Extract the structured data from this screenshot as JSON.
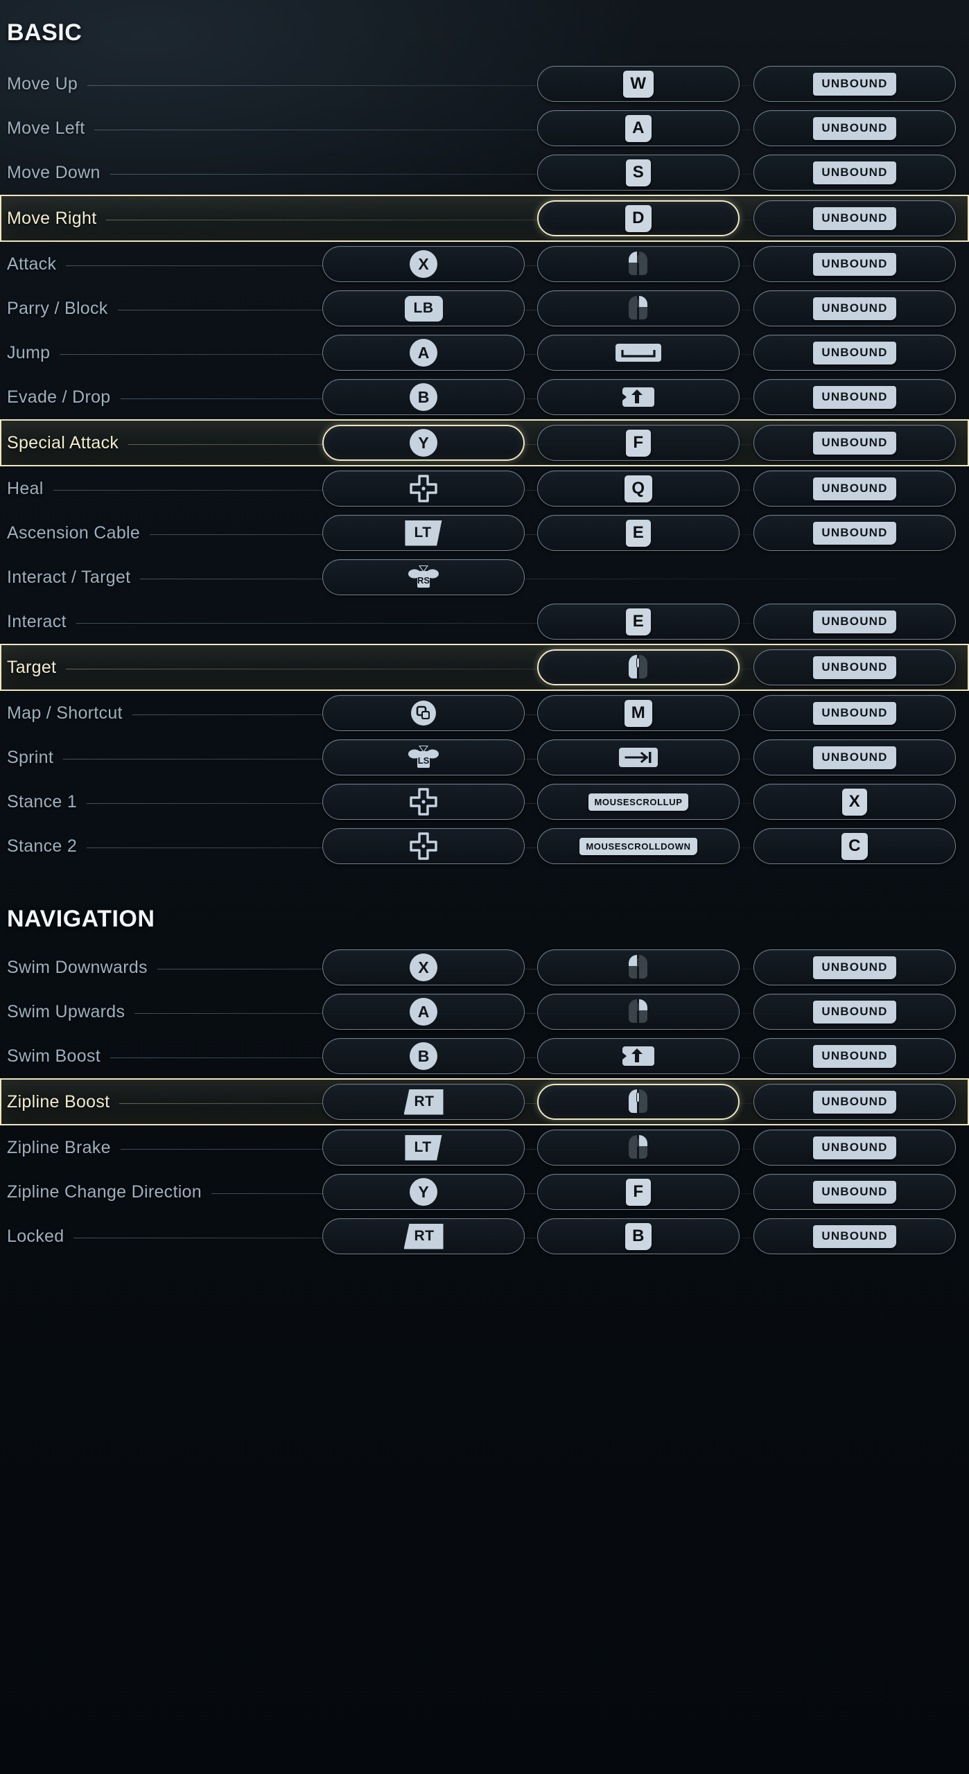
{
  "sections": [
    {
      "title": "BASIC",
      "rows": [
        {
          "label": "Move Up",
          "selected": false,
          "slots": [
            null,
            {
              "type": "keycap",
              "text": "W"
            },
            {
              "type": "unbound",
              "text": "UNBOUND"
            }
          ]
        },
        {
          "label": "Move Left",
          "selected": false,
          "slots": [
            null,
            {
              "type": "keycap",
              "text": "A"
            },
            {
              "type": "unbound",
              "text": "UNBOUND"
            }
          ]
        },
        {
          "label": "Move Down",
          "selected": false,
          "slots": [
            null,
            {
              "type": "keycap",
              "text": "S"
            },
            {
              "type": "unbound",
              "text": "UNBOUND"
            }
          ]
        },
        {
          "label": "Move Right",
          "selected": true,
          "activeSlot": 1,
          "slots": [
            null,
            {
              "type": "keycap",
              "text": "D"
            },
            {
              "type": "unbound",
              "text": "UNBOUND"
            }
          ]
        },
        {
          "label": "Attack",
          "selected": false,
          "slots": [
            {
              "type": "face",
              "text": "X"
            },
            {
              "type": "icon",
              "icon": "mouse-left-icon"
            },
            {
              "type": "unbound",
              "text": "UNBOUND"
            }
          ]
        },
        {
          "label": "Parry / Block",
          "selected": false,
          "slots": [
            {
              "type": "bumper",
              "text": "LB"
            },
            {
              "type": "icon",
              "icon": "mouse-right-icon"
            },
            {
              "type": "unbound",
              "text": "UNBOUND"
            }
          ]
        },
        {
          "label": "Jump",
          "selected": false,
          "slots": [
            {
              "type": "face",
              "text": "A"
            },
            {
              "type": "icon",
              "icon": "spacebar-icon"
            },
            {
              "type": "unbound",
              "text": "UNBOUND"
            }
          ]
        },
        {
          "label": "Evade / Drop",
          "selected": false,
          "slots": [
            {
              "type": "face",
              "text": "B"
            },
            {
              "type": "icon",
              "icon": "shift-key-icon"
            },
            {
              "type": "unbound",
              "text": "UNBOUND"
            }
          ]
        },
        {
          "label": "Special Attack",
          "selected": true,
          "activeSlot": 0,
          "slots": [
            {
              "type": "face",
              "text": "Y"
            },
            {
              "type": "keycap",
              "text": "F"
            },
            {
              "type": "unbound",
              "text": "UNBOUND"
            }
          ]
        },
        {
          "label": "Heal",
          "selected": false,
          "slots": [
            {
              "type": "icon",
              "icon": "dpad-icon"
            },
            {
              "type": "keycap",
              "text": "Q"
            },
            {
              "type": "unbound",
              "text": "UNBOUND"
            }
          ]
        },
        {
          "label": "Ascension Cable",
          "selected": false,
          "slots": [
            {
              "type": "trigger",
              "text": "LT"
            },
            {
              "type": "keycap",
              "text": "E"
            },
            {
              "type": "unbound",
              "text": "UNBOUND"
            }
          ]
        },
        {
          "label": "Interact / Target",
          "selected": false,
          "slots": [
            {
              "type": "icon",
              "icon": "right-stick-icon",
              "text": "RS"
            },
            null,
            null
          ]
        },
        {
          "label": "Interact",
          "selected": false,
          "slots": [
            null,
            {
              "type": "keycap",
              "text": "E"
            },
            {
              "type": "unbound",
              "text": "UNBOUND"
            }
          ]
        },
        {
          "label": "Target",
          "selected": true,
          "activeSlot": 1,
          "slots": [
            null,
            {
              "type": "icon",
              "icon": "mouse-middle-icon"
            },
            {
              "type": "unbound",
              "text": "UNBOUND"
            }
          ]
        },
        {
          "label": "Map / Shortcut",
          "selected": false,
          "slots": [
            {
              "type": "icon",
              "icon": "view-button-icon"
            },
            {
              "type": "keycap",
              "text": "M"
            },
            {
              "type": "unbound",
              "text": "UNBOUND"
            }
          ]
        },
        {
          "label": "Sprint",
          "selected": false,
          "slots": [
            {
              "type": "icon",
              "icon": "left-stick-icon",
              "text": "LS"
            },
            {
              "type": "icon",
              "icon": "tab-key-icon"
            },
            {
              "type": "unbound",
              "text": "UNBOUND"
            }
          ]
        },
        {
          "label": "Stance 1",
          "selected": false,
          "slots": [
            {
              "type": "icon",
              "icon": "dpad-icon"
            },
            {
              "type": "keycap-wide",
              "text": "MOUSESCROLLUP"
            },
            {
              "type": "keycap",
              "text": "X"
            }
          ]
        },
        {
          "label": "Stance 2",
          "selected": false,
          "slots": [
            {
              "type": "icon",
              "icon": "dpad-icon"
            },
            {
              "type": "keycap-wide",
              "text": "MOUSESCROLLDOWN"
            },
            {
              "type": "keycap",
              "text": "C"
            }
          ]
        }
      ]
    },
    {
      "title": "NAVIGATION",
      "rows": [
        {
          "label": "Swim Downwards",
          "selected": false,
          "slots": [
            {
              "type": "face",
              "text": "X"
            },
            {
              "type": "icon",
              "icon": "mouse-left-icon"
            },
            {
              "type": "unbound",
              "text": "UNBOUND"
            }
          ]
        },
        {
          "label": "Swim Upwards",
          "selected": false,
          "slots": [
            {
              "type": "face",
              "text": "A"
            },
            {
              "type": "icon",
              "icon": "mouse-right-icon"
            },
            {
              "type": "unbound",
              "text": "UNBOUND"
            }
          ]
        },
        {
          "label": "Swim Boost",
          "selected": false,
          "slots": [
            {
              "type": "face",
              "text": "B"
            },
            {
              "type": "icon",
              "icon": "shift-key-icon"
            },
            {
              "type": "unbound",
              "text": "UNBOUND"
            }
          ]
        },
        {
          "label": "Zipline Boost",
          "selected": true,
          "activeSlot": 1,
          "slots": [
            {
              "type": "trigger-rt",
              "text": "RT"
            },
            {
              "type": "icon",
              "icon": "mouse-middle-icon"
            },
            {
              "type": "unbound",
              "text": "UNBOUND"
            }
          ]
        },
        {
          "label": "Zipline Brake",
          "selected": false,
          "slots": [
            {
              "type": "trigger",
              "text": "LT"
            },
            {
              "type": "icon",
              "icon": "mouse-right-icon"
            },
            {
              "type": "unbound",
              "text": "UNBOUND"
            }
          ]
        },
        {
          "label": "Zipline Change Direction",
          "selected": false,
          "slots": [
            {
              "type": "face",
              "text": "Y"
            },
            {
              "type": "keycap",
              "text": "F"
            },
            {
              "type": "unbound",
              "text": "UNBOUND"
            }
          ]
        },
        {
          "label": "Locked",
          "selected": false,
          "slots": [
            {
              "type": "trigger-rt",
              "text": "RT"
            },
            {
              "type": "keycap",
              "text": "B"
            },
            {
              "type": "unbound",
              "text": "UNBOUND"
            }
          ]
        }
      ]
    }
  ],
  "colors": {
    "highlight": "#efe7c0",
    "keycap": "#ccd7e2",
    "label": "#9fb0bd",
    "background": "#080d12"
  }
}
